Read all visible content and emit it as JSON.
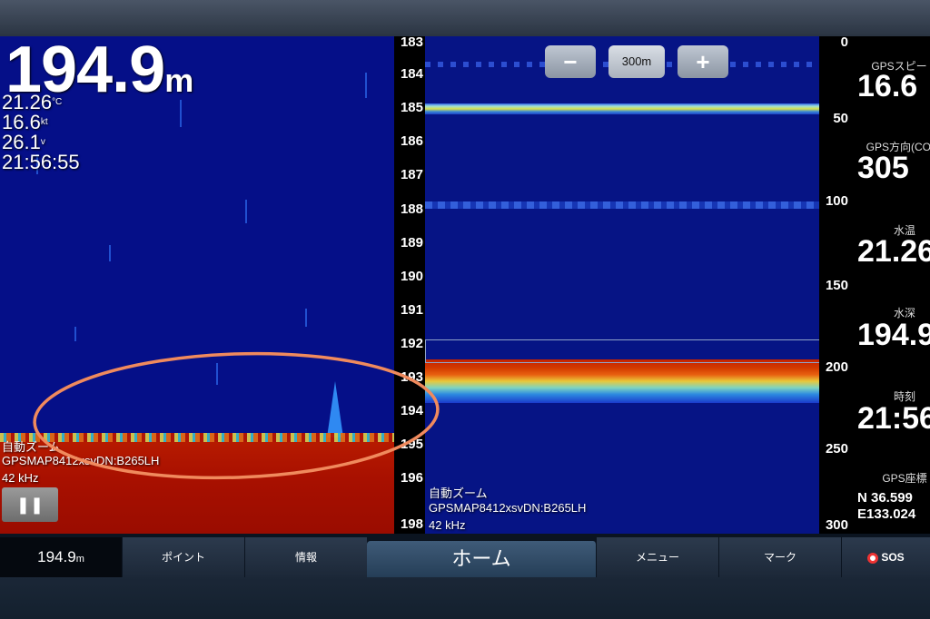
{
  "left": {
    "depth_value": "194.9",
    "depth_unit": "m",
    "temp_value": "21.26",
    "temp_unit": "°C",
    "speed_value": "16.6",
    "speed_unit": "kt",
    "voltage_value": "26.1",
    "voltage_unit": "v",
    "time": "21:56:55",
    "mode_label": "自動ズーム",
    "device_label": "GPSMAP8412xsvDN:B265LH",
    "frequency": "42 kHz",
    "pause_icon": "pause-icon",
    "scale_ticks": [
      "183",
      "184",
      "185",
      "186",
      "187",
      "188",
      "189",
      "190",
      "191",
      "192",
      "193",
      "194",
      "195",
      "196",
      "198"
    ]
  },
  "right": {
    "mode_label": "自動ズーム",
    "device_label": "GPSMAP8412xsvDN:B265LH",
    "frequency": "42 kHz",
    "zoom_minus": "−",
    "zoom_range": "300m",
    "zoom_plus": "+",
    "scale_ticks": [
      "0",
      "50",
      "100",
      "150",
      "200",
      "250",
      "300"
    ]
  },
  "data_panel": {
    "gps_speed_label": "GPSスピード",
    "gps_speed_value": "16.6",
    "gps_heading_label": "GPS方向(COG)",
    "gps_heading_value": "305",
    "water_temp_label": "水温",
    "water_temp_value": "21.26",
    "water_depth_label": "水深",
    "water_depth_value": "194.9",
    "time_label": "時刻",
    "time_value": "21:56",
    "gps_coord_label": "GPS座標",
    "lat": "N  36.599",
    "lon": "E133.024"
  },
  "bottom_bar": {
    "depth_value": "194.9",
    "depth_unit": "m",
    "point": "ポイント",
    "info": "情報",
    "home": "ホーム",
    "menu": "メニュー",
    "mark": "マーク",
    "sos": "SOS"
  },
  "colors": {
    "sonar_blue": "#061485",
    "bottom_red": "#a81000",
    "annotation_circle": "#f08a5d"
  }
}
